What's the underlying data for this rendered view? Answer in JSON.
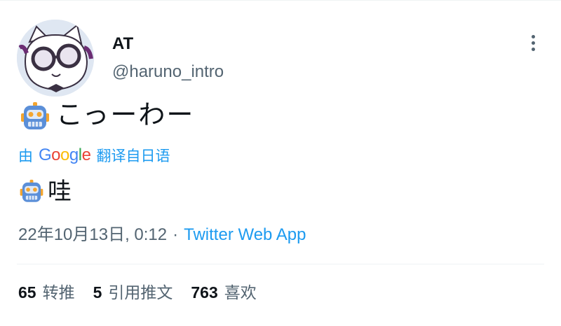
{
  "tweet": {
    "display_name": "AT",
    "handle": "@haruno_intro",
    "text": "こっーわー",
    "translate": {
      "by": "由",
      "provider": "Google",
      "action": "翻译自日语"
    },
    "translation": "哇",
    "timestamp": "22年10月13日, 0:12",
    "separator": "·",
    "source": "Twitter Web App",
    "stats": {
      "retweets_count": "65",
      "retweets_label": "转推",
      "quotes_count": "5",
      "quotes_label": "引用推文",
      "likes_count": "763",
      "likes_label": "喜欢"
    }
  },
  "colors": {
    "accent": "#1d9bf0",
    "secondary_text": "#536471",
    "divider": "#eff3f4",
    "google": [
      "#4285f4",
      "#ea4335",
      "#fbbc05",
      "#4285f4",
      "#34a853",
      "#ea4335"
    ]
  },
  "icons": {
    "avatar": "cartoon-cat-with-glasses",
    "more": "more-vertical-icon",
    "emoji": "robot-emoji"
  }
}
